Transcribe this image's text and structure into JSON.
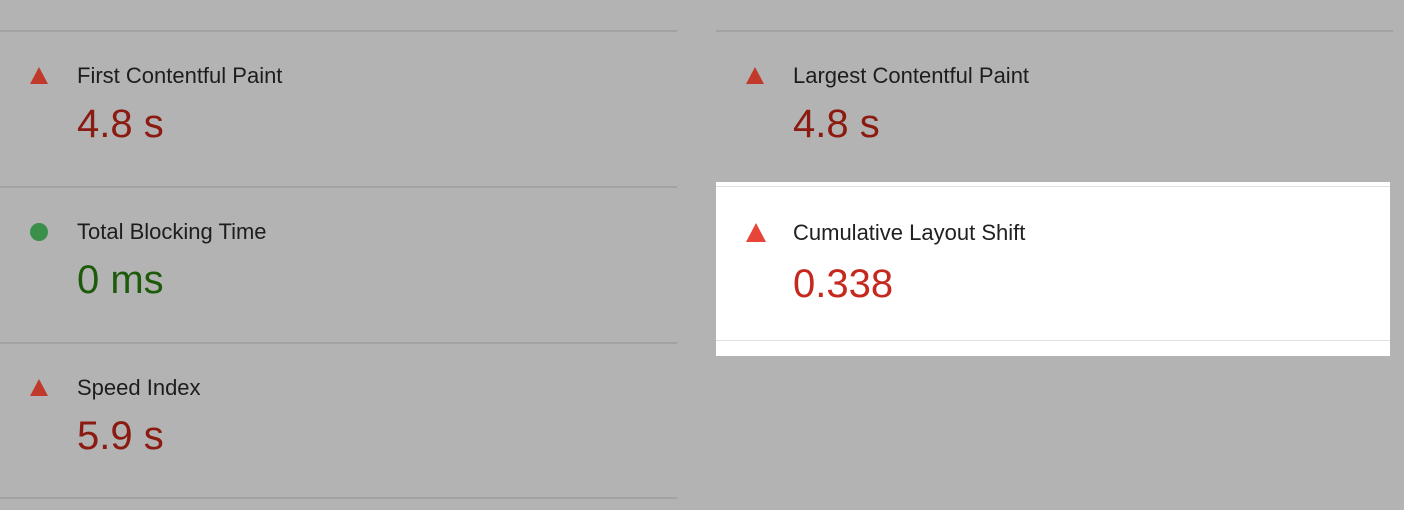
{
  "colors": {
    "background": "#b3b3b3",
    "fail": "#c0392b",
    "fail_text": "#8b1a11",
    "pass": "#3a8f4a",
    "pass_text": "#1e5a0c",
    "highlight_background": "#ffffff",
    "highlight_fail_text": "#c5281c"
  },
  "metrics_left": [
    {
      "label": "First Contentful Paint",
      "value": "4.8 s",
      "status": "fail",
      "icon": "warning-triangle-icon"
    },
    {
      "label": "Total Blocking Time",
      "value": "0 ms",
      "status": "pass",
      "icon": "pass-circle-icon"
    },
    {
      "label": "Speed Index",
      "value": "5.9 s",
      "status": "fail",
      "icon": "warning-triangle-icon"
    }
  ],
  "metrics_right": [
    {
      "label": "Largest Contentful Paint",
      "value": "4.8 s",
      "status": "fail",
      "icon": "warning-triangle-icon"
    }
  ],
  "highlighted_metric": {
    "label": "Cumulative Layout Shift",
    "value": "0.338",
    "status": "fail",
    "icon": "warning-triangle-icon"
  }
}
